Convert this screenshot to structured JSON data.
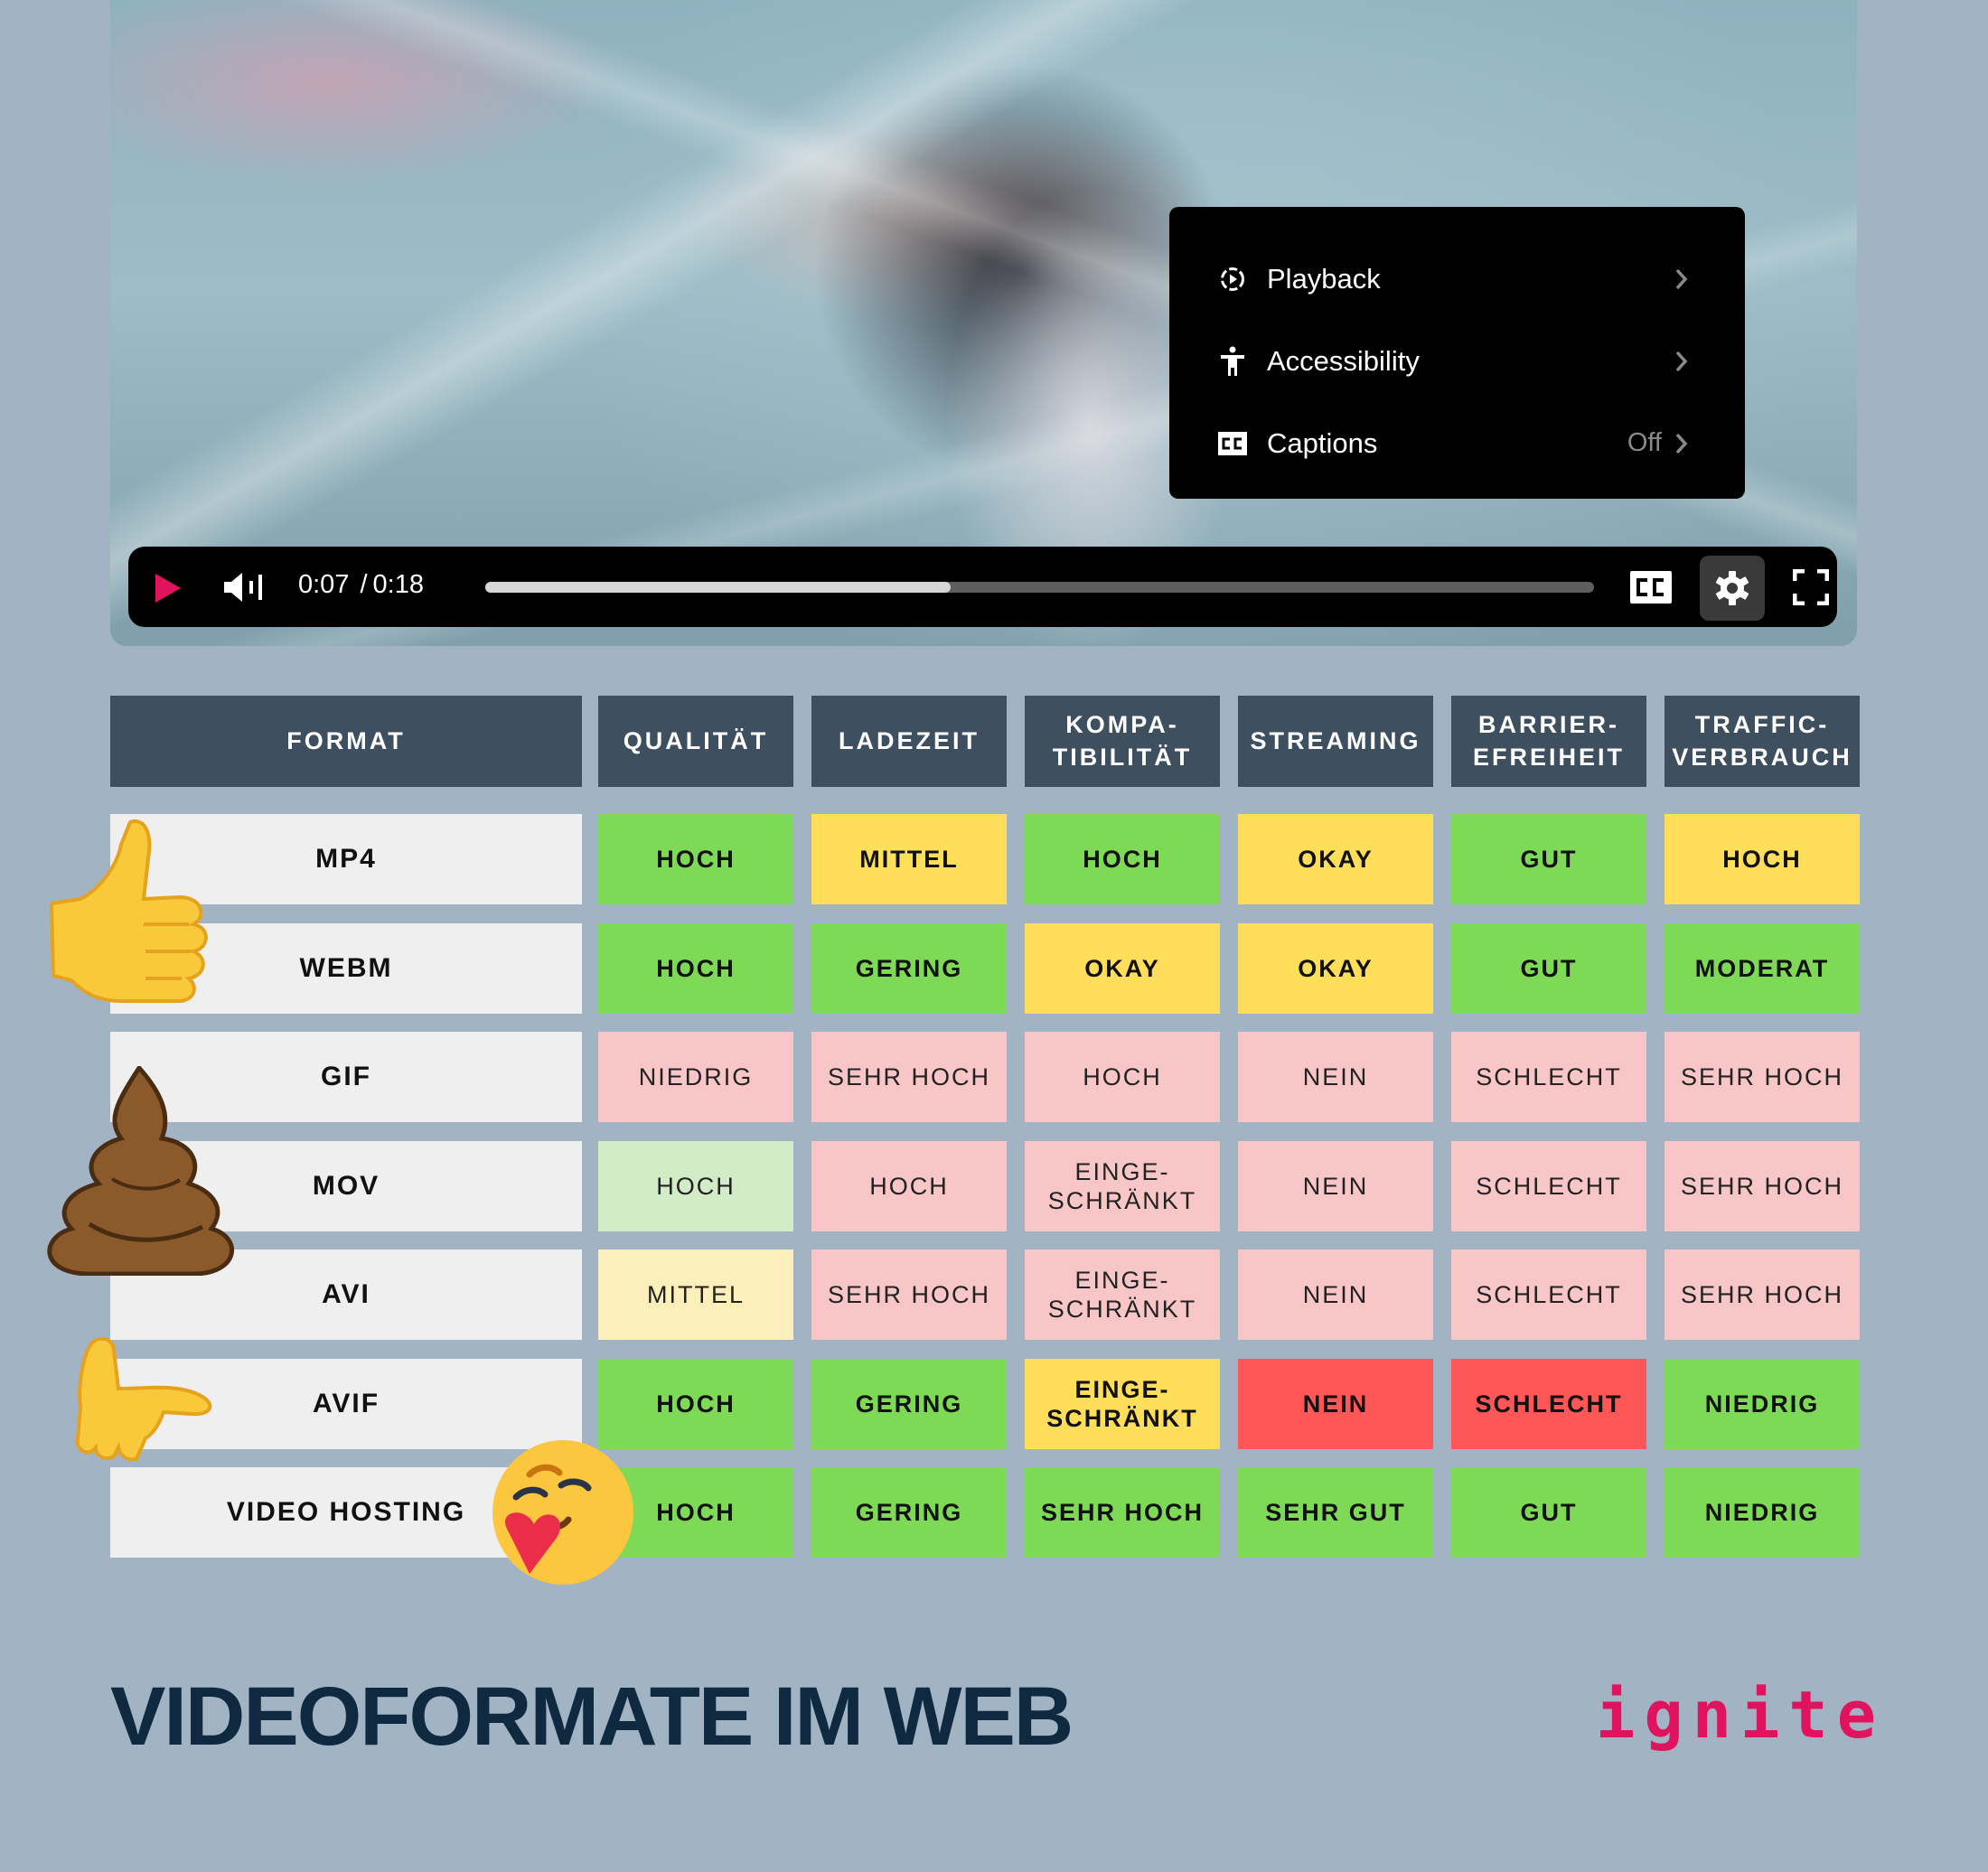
{
  "video": {
    "current_time": "0:07",
    "separator": "/",
    "duration": "0:18",
    "progress": 0.42,
    "settings_menu": {
      "items": [
        {
          "icon": "playback-icon",
          "label": "Playback",
          "value": ""
        },
        {
          "icon": "accessibility-icon",
          "label": "Accessibility",
          "value": ""
        },
        {
          "icon": "captions-icon",
          "label": "Captions",
          "value": "Off"
        }
      ]
    },
    "controls": {
      "play_icon": "play-icon",
      "volume_icon": "volume-icon",
      "cc_icon": "captions-icon",
      "settings_icon": "gear-icon",
      "fullscreen_icon": "fullscreen-icon"
    },
    "colors": {
      "accent": "#e0135e",
      "bar": "#000000",
      "progress_fill": "#d6d6d6",
      "progress_track": "#5e5e5e"
    }
  },
  "table": {
    "headers": [
      "FORMAT",
      "QUALITÄT",
      "LADEZEIT",
      "KOMPA-\nTIBILITÄT",
      "STREAMING",
      "BARRIER-\nEFREIHEIT",
      "TRAFFIC-\nVERBRAUCH"
    ],
    "rows": [
      {
        "format": "MP4",
        "cells": [
          {
            "text": "HOCH",
            "status": "good"
          },
          {
            "text": "MITTEL",
            "status": "medium"
          },
          {
            "text": "HOCH",
            "status": "good"
          },
          {
            "text": "OKAY",
            "status": "medium"
          },
          {
            "text": "GUT",
            "status": "good"
          },
          {
            "text": "HOCH",
            "status": "medium"
          }
        ]
      },
      {
        "format": "WEBM",
        "cells": [
          {
            "text": "HOCH",
            "status": "good"
          },
          {
            "text": "GERING",
            "status": "good"
          },
          {
            "text": "OKAY",
            "status": "medium"
          },
          {
            "text": "OKAY",
            "status": "medium"
          },
          {
            "text": "GUT",
            "status": "good"
          },
          {
            "text": "MODERAT",
            "status": "good"
          }
        ]
      },
      {
        "format": "GIF",
        "cells": [
          {
            "text": "NIEDRIG",
            "status": "bad-light"
          },
          {
            "text": "SEHR HOCH",
            "status": "bad-light"
          },
          {
            "text": "HOCH",
            "status": "bad-light"
          },
          {
            "text": "NEIN",
            "status": "bad-light"
          },
          {
            "text": "SCHLECHT",
            "status": "bad-light"
          },
          {
            "text": "SEHR HOCH",
            "status": "bad-light"
          }
        ]
      },
      {
        "format": "MOV",
        "cells": [
          {
            "text": "HOCH",
            "status": "good-light"
          },
          {
            "text": "HOCH",
            "status": "bad-light"
          },
          {
            "text": "EINGE-\nSCHRÄNKT",
            "status": "bad-light"
          },
          {
            "text": "NEIN",
            "status": "bad-light"
          },
          {
            "text": "SCHLECHT",
            "status": "bad-light"
          },
          {
            "text": "SEHR HOCH",
            "status": "bad-light"
          }
        ]
      },
      {
        "format": "AVI",
        "cells": [
          {
            "text": "MITTEL",
            "status": "medium-light"
          },
          {
            "text": "SEHR HOCH",
            "status": "bad-light"
          },
          {
            "text": "EINGE-\nSCHRÄNKT",
            "status": "bad-light"
          },
          {
            "text": "NEIN",
            "status": "bad-light"
          },
          {
            "text": "SCHLECHT",
            "status": "bad-light"
          },
          {
            "text": "SEHR HOCH",
            "status": "bad-light"
          }
        ]
      },
      {
        "format": "AVIF",
        "cells": [
          {
            "text": "HOCH",
            "status": "good"
          },
          {
            "text": "GERING",
            "status": "good"
          },
          {
            "text": "EINGE-\nSCHRÄNKT",
            "status": "medium"
          },
          {
            "text": "NEIN",
            "status": "bad"
          },
          {
            "text": "SCHLECHT",
            "status": "bad"
          },
          {
            "text": "NIEDRIG",
            "status": "good"
          }
        ]
      },
      {
        "format": "VIDEO HOSTING",
        "cells": [
          {
            "text": "HOCH",
            "status": "good"
          },
          {
            "text": "GERING",
            "status": "good"
          },
          {
            "text": "SEHR HOCH",
            "status": "good"
          },
          {
            "text": "SEHR GUT",
            "status": "good"
          },
          {
            "text": "GUT",
            "status": "good"
          },
          {
            "text": "NIEDRIG",
            "status": "good"
          }
        ]
      }
    ],
    "status_colors": {
      "good": "#7ed957",
      "medium": "#ffde59",
      "bad": "#ff5757",
      "good-light": "#d2ecc8",
      "medium-light": "#fbefbb",
      "bad-light": "#f8c6c6"
    },
    "header_color": "#3e5060",
    "format_cell_color": "#efefef"
  },
  "emojis": [
    {
      "name": "thumbs-up-emoji",
      "glyph": "👍",
      "row": "MP4/WEBM"
    },
    {
      "name": "poop-emoji",
      "glyph": "💩",
      "row": "GIF/MOV/AVI"
    },
    {
      "name": "palm-up-hand-emoji",
      "glyph": "🫴",
      "row": "AVIF"
    },
    {
      "name": "hugging-heart-emoji",
      "glyph": "🥰",
      "row": "VIDEO HOSTING"
    }
  ],
  "footer": {
    "title": "VIDEOFORMATE IM WEB",
    "logo": "ignite",
    "title_color": "#0f2a40",
    "logo_color": "#e0135e"
  }
}
